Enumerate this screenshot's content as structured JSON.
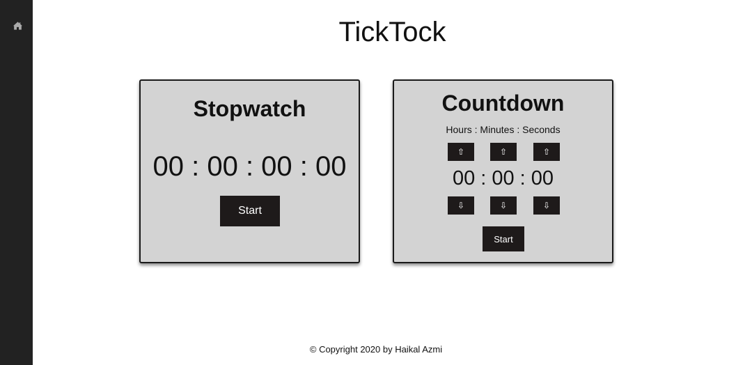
{
  "sidebar": {
    "home_icon": "home-icon"
  },
  "app": {
    "title": "TickTock"
  },
  "stopwatch": {
    "title": "Stopwatch",
    "display": "00 : 00 : 00 : 00",
    "start_label": "Start"
  },
  "countdown": {
    "title": "Countdown",
    "format_label": "Hours : Minutes : Seconds",
    "up_arrow": "⇧",
    "down_arrow": "⇩",
    "display": "00 : 00 : 00",
    "start_label": "Start"
  },
  "footer": {
    "text": "© Copyright 2020 by Haikal Azmi"
  },
  "colors": {
    "sidebar_bg": "#222222",
    "card_bg": "#d3d3d3",
    "button_bg": "#1e1a1a"
  }
}
